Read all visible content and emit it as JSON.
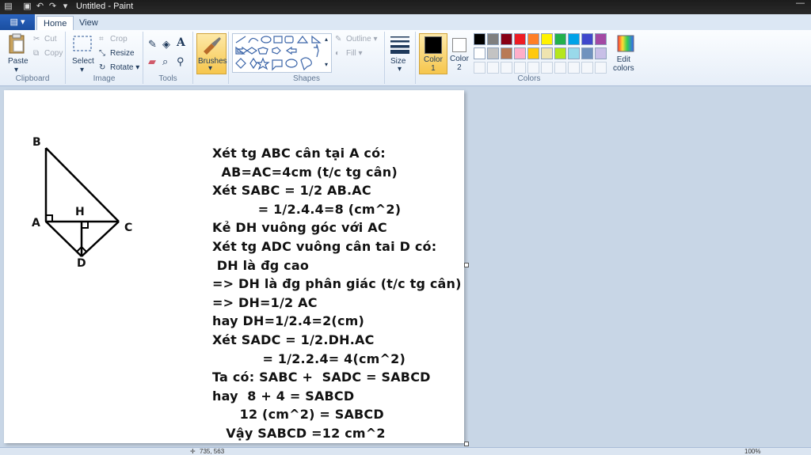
{
  "window": {
    "title": "Untitled - Paint"
  },
  "tabs": [
    {
      "label": "Home"
    },
    {
      "label": "View"
    }
  ],
  "clipboard": {
    "paste": "Paste",
    "cut": "Cut",
    "copy": "Copy",
    "label": "Clipboard"
  },
  "image": {
    "select": "Select",
    "crop": "Crop",
    "resize": "Resize",
    "rotate": "Rotate",
    "label": "Image"
  },
  "tools": {
    "label": "Tools"
  },
  "brushes": {
    "label": "Brushes"
  },
  "shapes": {
    "outline": "Outline",
    "fill": "Fill",
    "label": "Shapes"
  },
  "size": {
    "label": "Size"
  },
  "colors": {
    "color1": "Color\n1",
    "color2": "Color\n2",
    "edit": "Edit\ncolors",
    "label": "Colors",
    "color1_hex": "#000000",
    "color2_hex": "#ffffff",
    "row1": [
      "#000000",
      "#7f7f7f",
      "#880015",
      "#ed1c24",
      "#ff7f27",
      "#fff200",
      "#22b14c",
      "#00a2e8",
      "#3f48cc",
      "#a349a4"
    ],
    "row2": [
      "#ffffff",
      "#c3c3c3",
      "#b97a57",
      "#ffaec9",
      "#ffc90e",
      "#efe4b0",
      "#b5e61d",
      "#99d9ea",
      "#7092be",
      "#c8bfe7"
    ]
  },
  "diagram": {
    "B": "B",
    "A": "A",
    "H": "H",
    "C": "C",
    "D": "D"
  },
  "text_lines": [
    "Xét tg ABC cân tại A có:",
    "  AB=AC=4cm (t/c tg cân)",
    "Xét SABC = 1/2 AB.AC",
    "          = 1/2.4.4=8 (cm^2)",
    "Kẻ DH vuông góc với AC",
    "Xét tg ADC vuông cân tai D có:",
    " DH là đg cao",
    "=> DH là đg phân giác (t/c tg cân)",
    "=> DH=1/2 AC",
    "hay DH=1/2.4=2(cm)",
    "Xét SADC = 1/2.DH.AC",
    "           = 1/2.2.4= 4(cm^2)",
    "Ta có: SABC +  SADC = SABCD",
    "hay  8 + 4 = SABCD",
    "      12 (cm^2) = SABCD",
    "   Vậy SABCD =12 cm^2"
  ],
  "status": {
    "coords": "735, 563",
    "zoom": "100%"
  }
}
